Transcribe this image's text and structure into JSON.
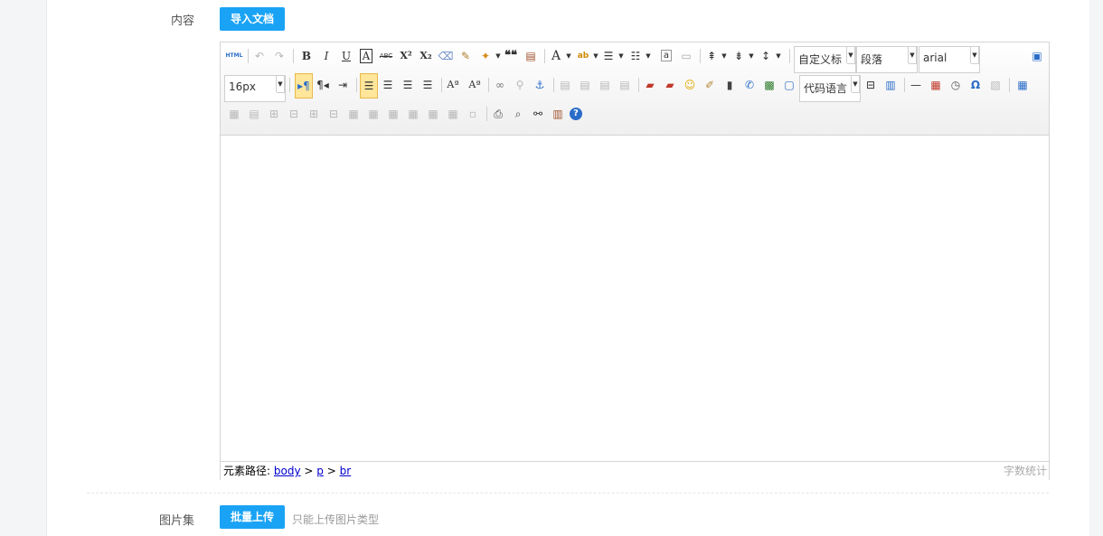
{
  "form": {
    "content_label": "内容",
    "import_button": "导入文档",
    "gallery_label": "图片集",
    "batch_upload_button": "批量上传",
    "upload_hint": "只能上传图片类型"
  },
  "toolbar": {
    "custom_title": "自定义标",
    "paragraph": "段落",
    "font_family": "arial",
    "font_size": "16px",
    "code_language": "代码语言"
  },
  "statusbar": {
    "path_label": "元素路径:",
    "path": [
      "body",
      "p",
      "br"
    ],
    "separator": ">",
    "word_count_label": "字数统计"
  },
  "icons": {
    "html_text": "HTML",
    "bold": "B",
    "italic": "I",
    "underline": "U",
    "font_border": "A",
    "strikethrough": "ABC",
    "superscript": "X²",
    "subscript": "X₂",
    "blockquote": "❝❝",
    "forecolor": "A",
    "backcolor": "ab",
    "autotype_1": "Aª",
    "autotype_2": "Aª",
    "horizontal_rule": "—",
    "special_char": "Ω"
  },
  "colors": {
    "accent": "#1aa3f5"
  }
}
